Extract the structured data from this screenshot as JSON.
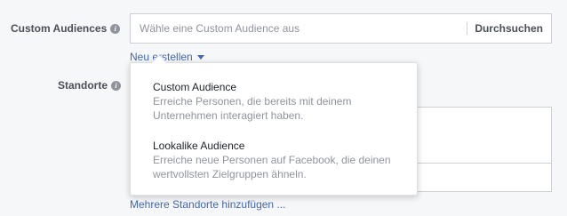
{
  "fields": {
    "audiences": {
      "label": "Custom Audiences",
      "placeholder": "Wähle eine Custom Audience aus",
      "value": "",
      "browse_label": "Durchsuchen",
      "create_new_label": "Neu erstellen"
    },
    "locations": {
      "label": "Standorte",
      "add_more_label": "Mehrere Standorte hinzufügen ..."
    }
  },
  "dropdown": {
    "options": [
      {
        "title": "Custom Audience",
        "description": "Erreiche Personen, die bereits mit deinem Unternehmen interagiert haben."
      },
      {
        "title": "Lookalike Audience",
        "description": "Erreiche neue Personen auf Facebook, die deinen wertvollsten Zielgruppen ähneln."
      }
    ]
  },
  "icons": {
    "info": "info-icon",
    "caret": "chevron-down-icon"
  },
  "colors": {
    "link": "#4267b2",
    "label": "#4b4f56",
    "muted": "#90949c",
    "border": "#ccd0d5"
  }
}
